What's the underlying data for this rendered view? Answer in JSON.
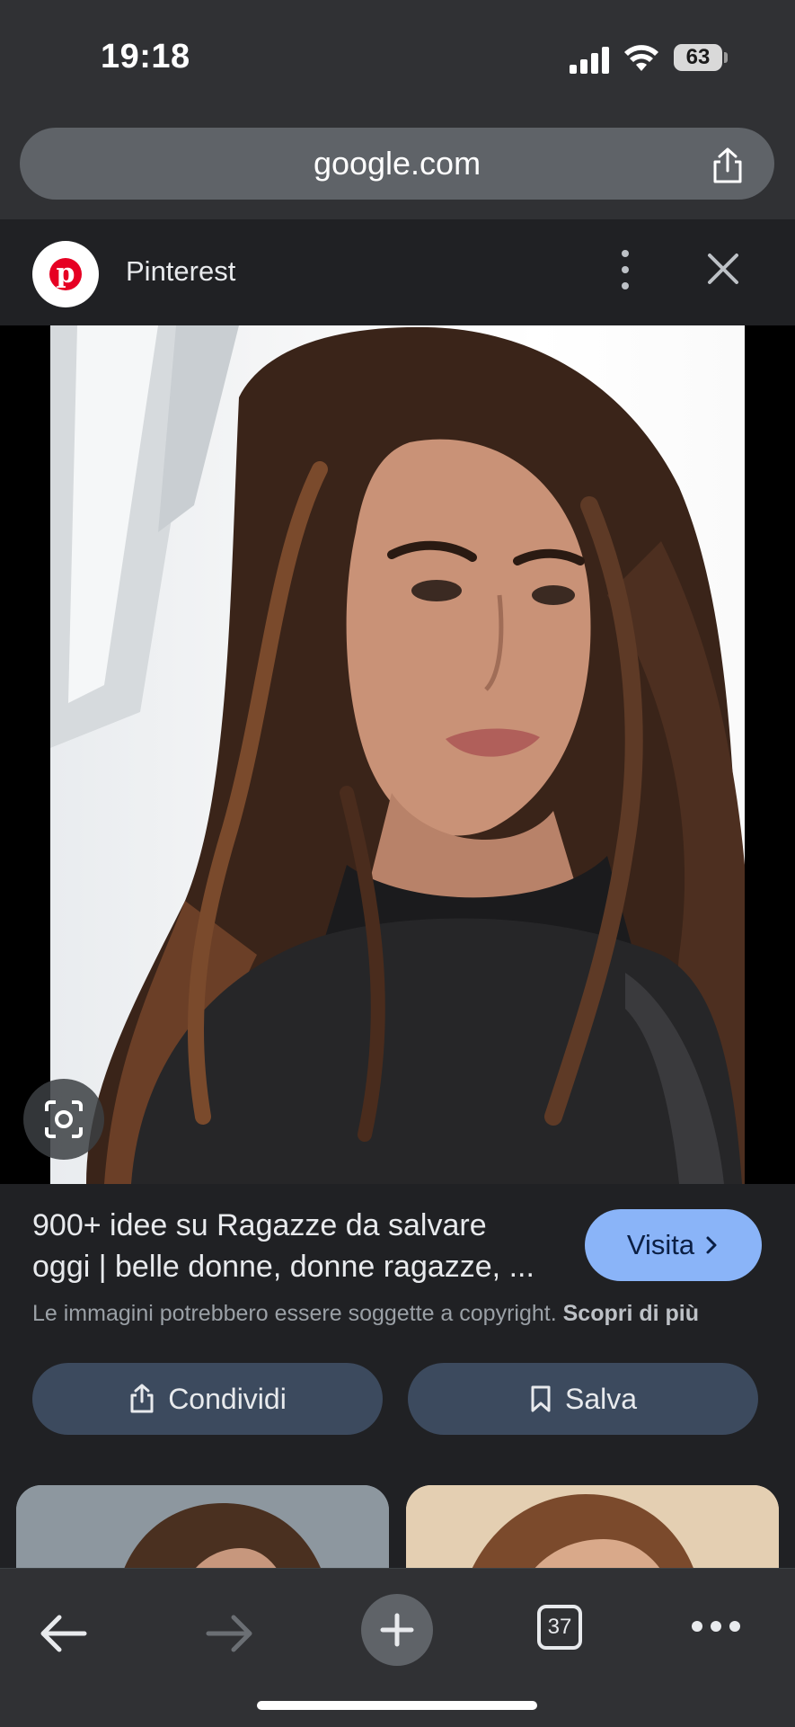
{
  "status_bar": {
    "time": "19:18",
    "battery": "63"
  },
  "browser": {
    "url": "google.com",
    "tab_count": "37"
  },
  "site": {
    "name": "Pinterest",
    "logo_letter": "p"
  },
  "result": {
    "title_line1": "900+ idee su Ragazze da salvare",
    "title_line2": "oggi | belle donne, donne ragazze, ...",
    "visit_label": "Visita",
    "copyright_text": "Le immagini potrebbero essere soggette a copyright.",
    "learn_more": "Scopri di più",
    "share_label": "Condividi",
    "save_label": "Salva"
  },
  "icons": {
    "share": "share-icon",
    "menu": "more-vert-icon",
    "close": "close-icon",
    "lens": "lens-icon",
    "back": "back-arrow-icon",
    "forward": "forward-arrow-icon",
    "new_tab": "plus-icon",
    "tabs": "tab-switcher-icon",
    "more": "more-horiz-icon"
  },
  "colors": {
    "accent": "#8ab4f8",
    "pinterest_red": "#e60023",
    "button_bg": "#3c4a5e"
  }
}
